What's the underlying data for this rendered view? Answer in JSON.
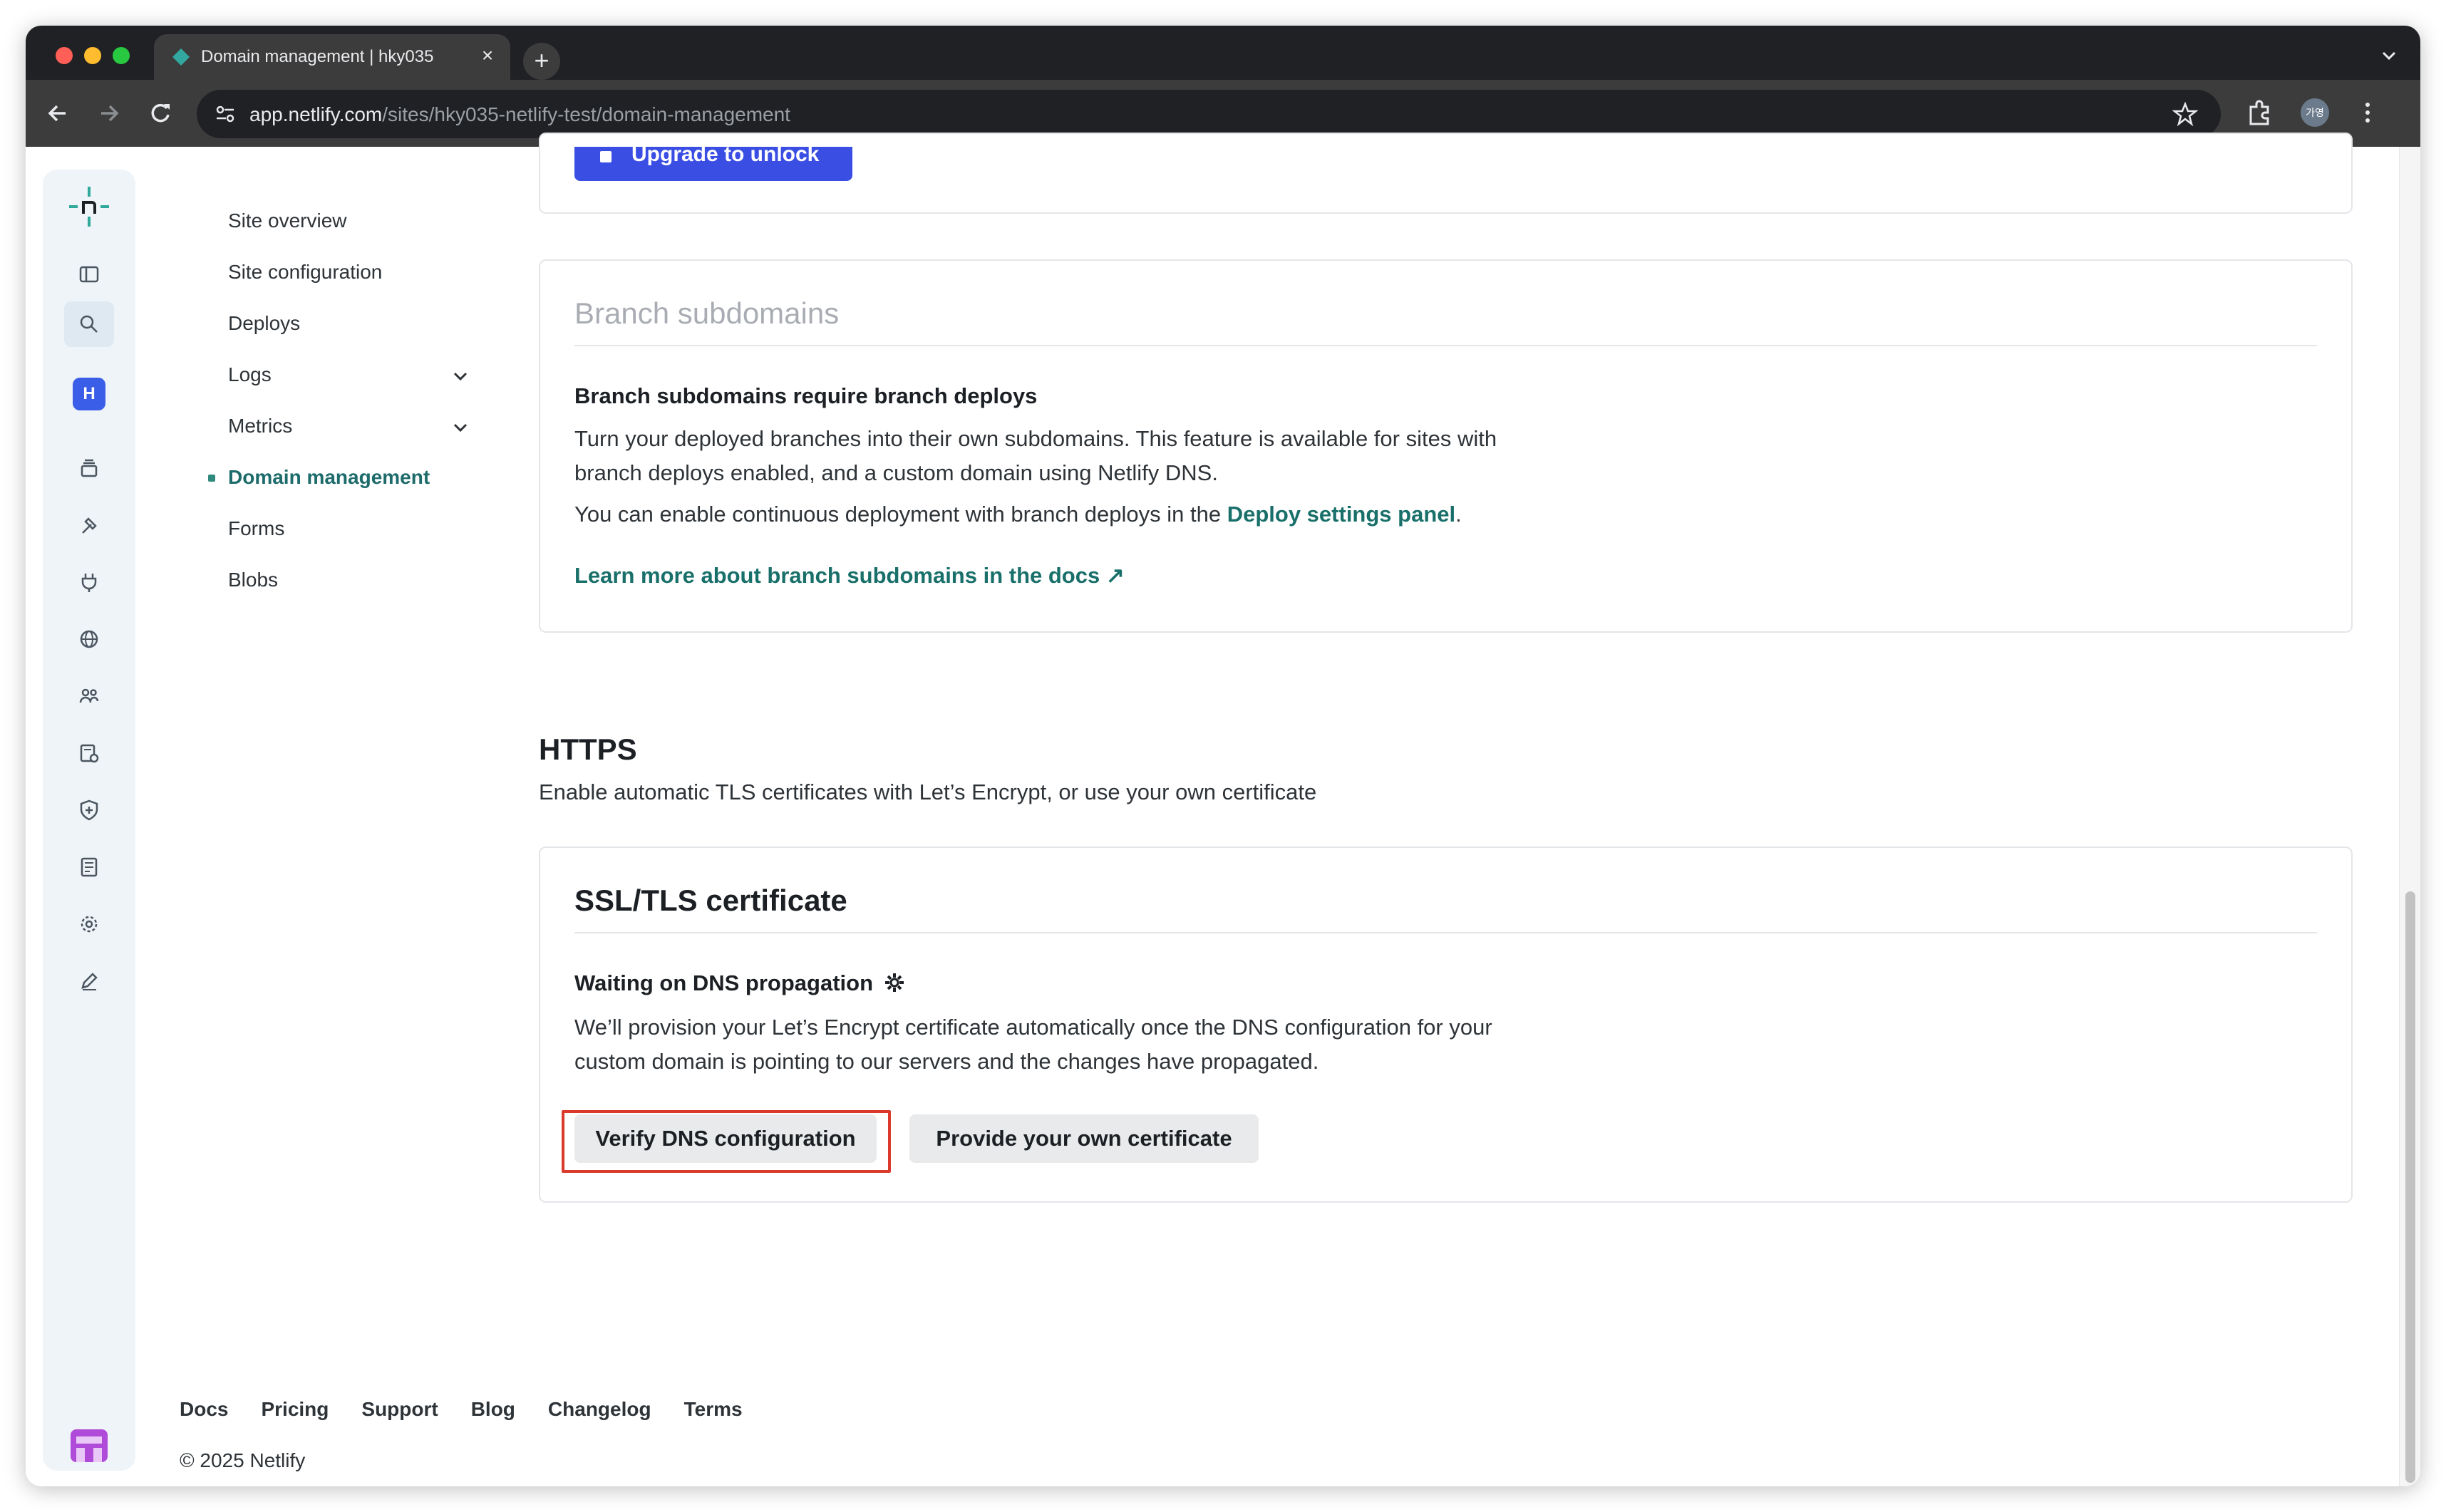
{
  "browser": {
    "tab_title": "Domain management | hky035",
    "url_host": "app.netlify.com",
    "url_path": "/sites/hky035-netlify-test/domain-management",
    "profile_initials": "가영"
  },
  "rail": {
    "team_badge": "H"
  },
  "secondary_nav": {
    "items": [
      {
        "label": "Site overview"
      },
      {
        "label": "Site configuration"
      },
      {
        "label": "Deploys"
      },
      {
        "label": "Logs"
      },
      {
        "label": "Metrics"
      },
      {
        "label": "Domain management"
      },
      {
        "label": "Forms"
      },
      {
        "label": "Blobs"
      }
    ]
  },
  "upgrade": {
    "label": "Upgrade to unlock"
  },
  "branch_subdomains": {
    "title": "Branch subdomains",
    "subtitle": "Branch subdomains require branch deploys",
    "paragraph1": "Turn your deployed branches into their own subdomains. This feature is available for sites with branch deploys enabled, and a custom domain using Netlify DNS.",
    "paragraph2_prefix": "You can enable continuous deployment with branch deploys in the ",
    "paragraph2_link": "Deploy settings panel",
    "paragraph2_suffix": ".",
    "docs_link": "Learn more about branch subdomains in the docs ↗"
  },
  "https": {
    "title": "HTTPS",
    "description": "Enable automatic TLS certificates with Let’s Encrypt, or use your own certificate"
  },
  "ssl": {
    "title": "SSL/TLS certificate",
    "status": "Waiting on DNS propagation",
    "description": "We’ll provision your Let’s Encrypt certificate automatically once the DNS configuration for your custom domain is pointing to our servers and the changes have propagated.",
    "verify_button": "Verify DNS configuration",
    "own_cert_button": "Provide your own certificate"
  },
  "footer": {
    "links": [
      "Docs",
      "Pricing",
      "Support",
      "Blog",
      "Changelog",
      "Terms"
    ],
    "copyright": "© 2025 Netlify"
  },
  "colors": {
    "accent": "#19706a",
    "upgrade": "#3a4ee4",
    "highlight": "#d93a2b"
  }
}
